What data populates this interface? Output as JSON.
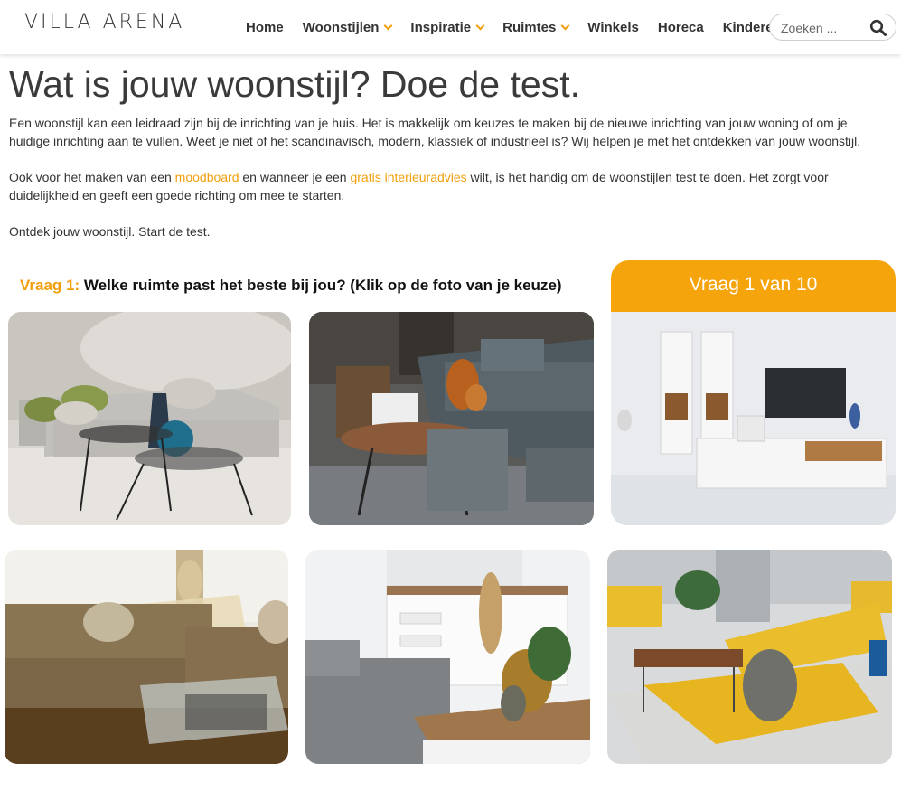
{
  "header": {
    "logo": "VILLA ARENA",
    "nav": [
      {
        "label": "Home",
        "dropdown": false
      },
      {
        "label": "Woonstijlen",
        "dropdown": true
      },
      {
        "label": "Inspiratie",
        "dropdown": true
      },
      {
        "label": "Ruimtes",
        "dropdown": true
      },
      {
        "label": "Winkels",
        "dropdown": false
      },
      {
        "label": "Horeca",
        "dropdown": false
      },
      {
        "label": "Kinderen",
        "dropdown": false
      }
    ],
    "search": {
      "placeholder": "Zoeken ...",
      "value": "",
      "icon": "search-icon"
    }
  },
  "intro": {
    "title": "Wat is jouw woonstijl? Doe de test.",
    "p1": "Een woonstijl kan een leidraad zijn bij de inrichting van je huis. Het is makkelijk om keuzes te maken bij de nieuwe inrichting van jouw woning of om je huidige inrichting aan te vullen. Weet je niet of het scandinavisch, modern, klassiek of industrieel is? Wij helpen je met het ontdekken van jouw woonstijl.",
    "p2_a": "Ook voor het maken van een ",
    "p2_link1": "moodboard",
    "p2_b": " en wanneer je een ",
    "p2_link2": "gratis interieuradvies",
    "p2_c": " wilt, is het handig om de woonstijlen test te doen. Het zorgt voor duidelijkheid en geeft een goede richting om mee te starten.",
    "p3": "Ontdek jouw woonstijl. Start de test."
  },
  "quiz": {
    "question_num": "Vraag 1:",
    "question_text": "Welke ruimte past het beste bij jou? (Klik op de foto van je keuze)",
    "progress": "Vraag 1 van 10",
    "progress_current": 1,
    "progress_total": 10
  },
  "colors": {
    "accent": "#f29e0b",
    "progress_bg": "#f5a40c",
    "text": "#333333"
  }
}
